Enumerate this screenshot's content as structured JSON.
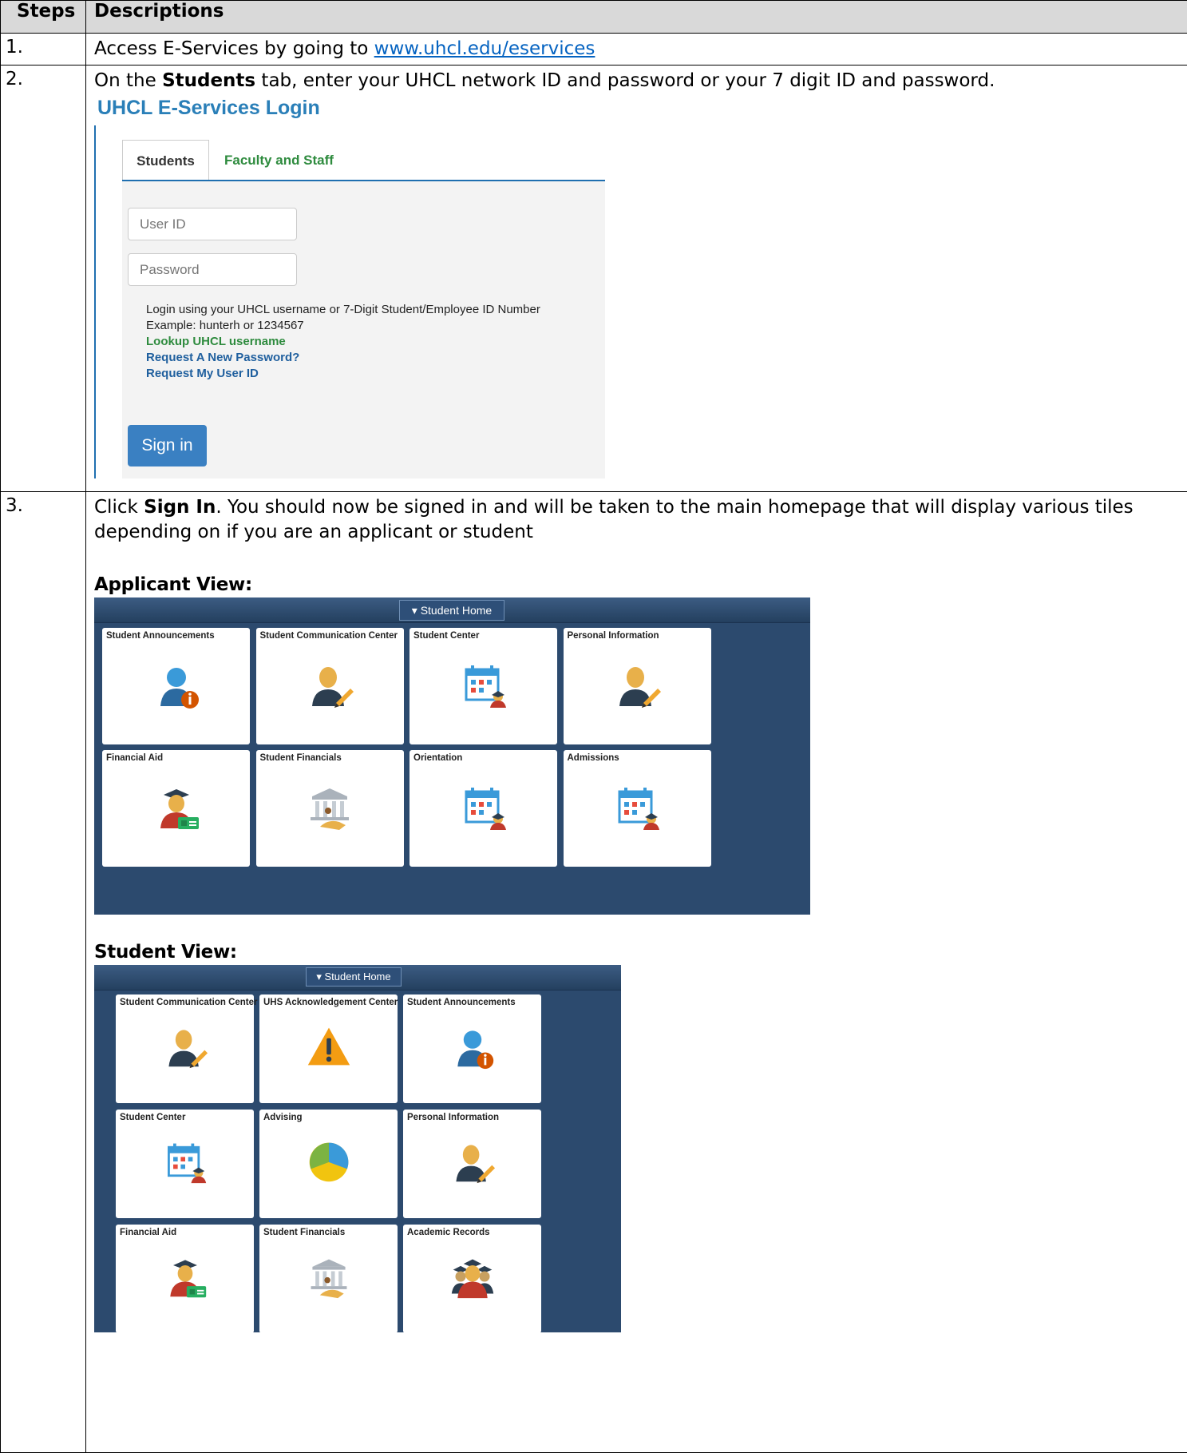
{
  "table": {
    "headers": [
      "Steps",
      "Descriptions"
    ],
    "rows": [
      {
        "step": "1.",
        "text_prefix": "Access E-Services by going to ",
        "link": "www.uhcl.edu/eservices"
      },
      {
        "step": "2.",
        "text_a": "On the ",
        "bold": "Students",
        "text_b": " tab, enter your UHCL network ID and password or your 7 digit ID and password."
      },
      {
        "step": "3.",
        "bold": "Sign In",
        "text_a": "Click ",
        "text_b": ". You should now be signed in and will be taken to the main homepage that will display various tiles depending on if you are an applicant or student"
      }
    ]
  },
  "login": {
    "title": "UHCL E-Services Login",
    "tabs": [
      "Students",
      "Faculty and Staff"
    ],
    "user_placeholder": "User ID",
    "password_placeholder": "Password",
    "help_line1": "Login using your UHCL username or 7-Digit Student/Employee ID Number",
    "help_line2": "Example: hunterh or 1234567",
    "lookup_link": "Lookup UHCL username",
    "new_password_link": "Request A New Password?",
    "user_id_link": "Request My User ID",
    "signin_label": "Sign in"
  },
  "applicant": {
    "label": "Applicant View:",
    "home": "▾ Student Home",
    "tiles": [
      {
        "title": "Student Announcements",
        "icon": "person-info-icon"
      },
      {
        "title": "Student Communication Center",
        "icon": "person-pencil-icon"
      },
      {
        "title": "Student Center",
        "icon": "calendar-student-icon"
      },
      {
        "title": "Personal Information",
        "icon": "person-pencil-icon"
      },
      {
        "title": "Financial Aid",
        "icon": "graduate-money-icon"
      },
      {
        "title": "Student Financials",
        "icon": "bank-hand-icon"
      },
      {
        "title": "Orientation",
        "icon": "calendar-student-icon"
      },
      {
        "title": "Admissions",
        "icon": "calendar-student-icon"
      }
    ]
  },
  "student": {
    "label": "Student View:",
    "home": "▾ Student Home",
    "tiles": [
      {
        "title": "Student Communication Center",
        "icon": "person-pencil-icon"
      },
      {
        "title": "UHS Acknowledgement Center",
        "icon": "warning-icon"
      },
      {
        "title": "Student Announcements",
        "icon": "person-info-icon"
      },
      {
        "title": "Student Center",
        "icon": "calendar-student-icon"
      },
      {
        "title": "Advising",
        "icon": "pie-chart-icon"
      },
      {
        "title": "Personal Information",
        "icon": "person-pencil-icon"
      },
      {
        "title": "Financial Aid",
        "icon": "graduate-money-icon"
      },
      {
        "title": "Student Financials",
        "icon": "bank-hand-icon"
      },
      {
        "title": "Academic Records",
        "icon": "graduates-group-icon"
      }
    ]
  }
}
